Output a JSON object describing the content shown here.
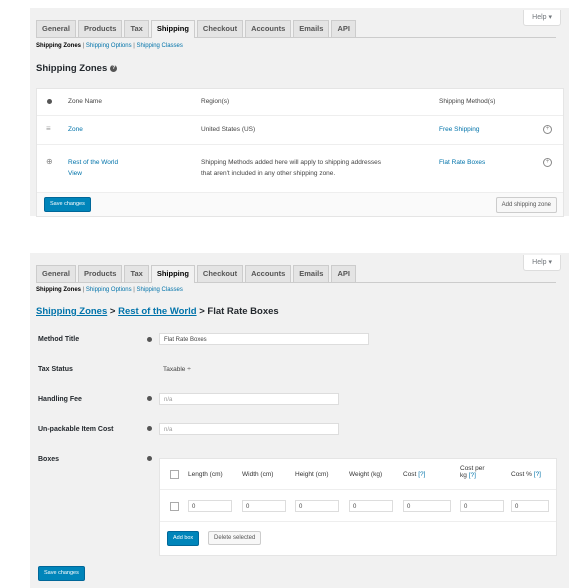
{
  "help_label": "Help ▾",
  "tabs": [
    "General",
    "Products",
    "Tax",
    "Shipping",
    "Checkout",
    "Accounts",
    "Emails",
    "API"
  ],
  "subnav": {
    "current": "Shipping Zones",
    "sep": "|",
    "links": [
      "Shipping Options",
      "Shipping Classes"
    ]
  },
  "zones": {
    "title": "Shipping Zones",
    "columns": {
      "name": "Zone Name",
      "region": "Region(s)",
      "methods": "Shipping Method(s)"
    },
    "rows": [
      {
        "name": "Zone",
        "region": "United States (US)",
        "method": "Free Shipping"
      },
      {
        "name": "Rest of the World",
        "view": "View",
        "region_line1": "Shipping Methods added here will apply to shipping addresses",
        "region_line2": "that aren't included in any other shipping zone.",
        "method": "Flat Rate Boxes"
      }
    ],
    "save_label": "Save changes",
    "add_label": "Add shipping zone"
  },
  "method": {
    "breadcrumb": {
      "zones": "Shipping Zones",
      "sep1": ">",
      "rest": "Rest of the World",
      "sep2": ">",
      "current": "Flat Rate Boxes"
    },
    "fields": {
      "title_label": "Method Title",
      "title_value": "Flat Rate Boxes",
      "tax_label": "Tax Status",
      "tax_value": "Taxable ÷",
      "handling_label": "Handling Fee",
      "handling_placeholder": "n/a",
      "unpack_label": "Un-packable Item Cost",
      "unpack_placeholder": "n/a",
      "boxes_label": "Boxes"
    },
    "boxes": {
      "headers": [
        "Length (cm)",
        "Width (cm)",
        "Height (cm)",
        "Weight (kg)"
      ],
      "cost_label": "Cost",
      "cost_per_kg_label1": "Cost per",
      "cost_per_kg_label2": "kg",
      "cost_pct_label": "Cost %",
      "help_marker": "[?]",
      "row_values": [
        "0",
        "0",
        "0",
        "0",
        "0",
        "0",
        "0"
      ],
      "add_label": "Add box",
      "delete_label": "Delete selected"
    },
    "save_label": "Save changes"
  }
}
